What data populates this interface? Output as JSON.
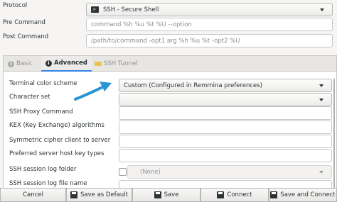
{
  "form": {
    "protocol_label": "Protocol",
    "protocol_value": "SSH - Secure Shell",
    "pre_command_label": "Pre Command",
    "pre_command_placeholder": "command %h %u %t %U --option",
    "post_command_label": "Post Command",
    "post_command_placeholder": "/path/to/command -opt1 arg %h %u %t -opt2 %U"
  },
  "tabs": [
    {
      "label": "Basic",
      "icon": "basic-icon",
      "active": false
    },
    {
      "label": "Advanced",
      "icon": "advanced-icon",
      "active": true
    },
    {
      "label": "SSH Tunnel",
      "icon": "ssh-tunnel-icon",
      "active": false
    }
  ],
  "advanced": {
    "color_scheme_label": "Terminal color scheme",
    "color_scheme_value": "Custom (Configured in Remmina preferences)",
    "charset_label": "Character set",
    "charset_value": "",
    "proxy_label": "SSH Proxy Command",
    "kex_label": "KEX (Key Exchange) algorithms",
    "cipher_label": "Symmetric cipher client to server",
    "hostkey_label": "Preferred server host key types",
    "log_folder_label": "SSH session log folder",
    "log_folder_value": "(None)",
    "log_file_label": "SSH session log file name"
  },
  "buttons": {
    "cancel": "Cancel",
    "save_default": "Save as Default",
    "save": "Save",
    "connect": "Connect",
    "save_connect": "Save and Connect"
  },
  "colors": {
    "accent": "#3584e4",
    "annotation_arrow": "#2a93d5"
  }
}
